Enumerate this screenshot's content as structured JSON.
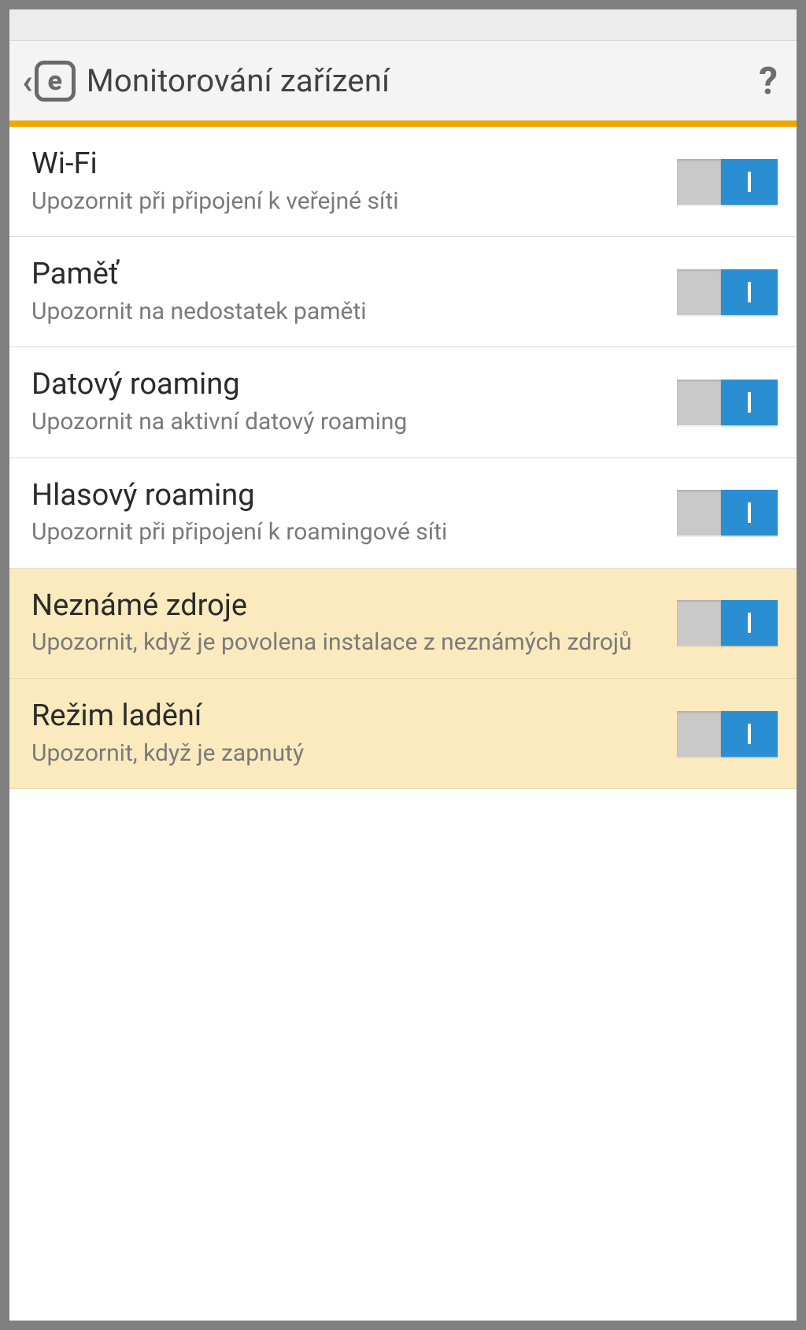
{
  "header": {
    "title": "Monitorování zařízení",
    "logo_letter": "e",
    "help_glyph": "?"
  },
  "settings": [
    {
      "id": "wifi",
      "title": "Wi-Fi",
      "subtitle": "Upozornit při připojení k veřejné síti",
      "on": true,
      "highlight": false
    },
    {
      "id": "memory",
      "title": "Paměť",
      "subtitle": "Upozornit na nedostatek paměti",
      "on": true,
      "highlight": false
    },
    {
      "id": "data-roaming",
      "title": "Datový roaming",
      "subtitle": "Upozornit na aktivní datový roaming",
      "on": true,
      "highlight": false
    },
    {
      "id": "voice-roaming",
      "title": "Hlasový roaming",
      "subtitle": "Upozornit při připojení k roamingové síti",
      "on": true,
      "highlight": false
    },
    {
      "id": "unknown-sources",
      "title": "Neznámé zdroje",
      "subtitle": "Upozornit, když je povolena instalace z neznámých zdrojů",
      "on": true,
      "highlight": true
    },
    {
      "id": "debug-mode",
      "title": "Režim ladění",
      "subtitle": "Upozornit, když je zapnutý",
      "on": true,
      "highlight": true
    }
  ]
}
